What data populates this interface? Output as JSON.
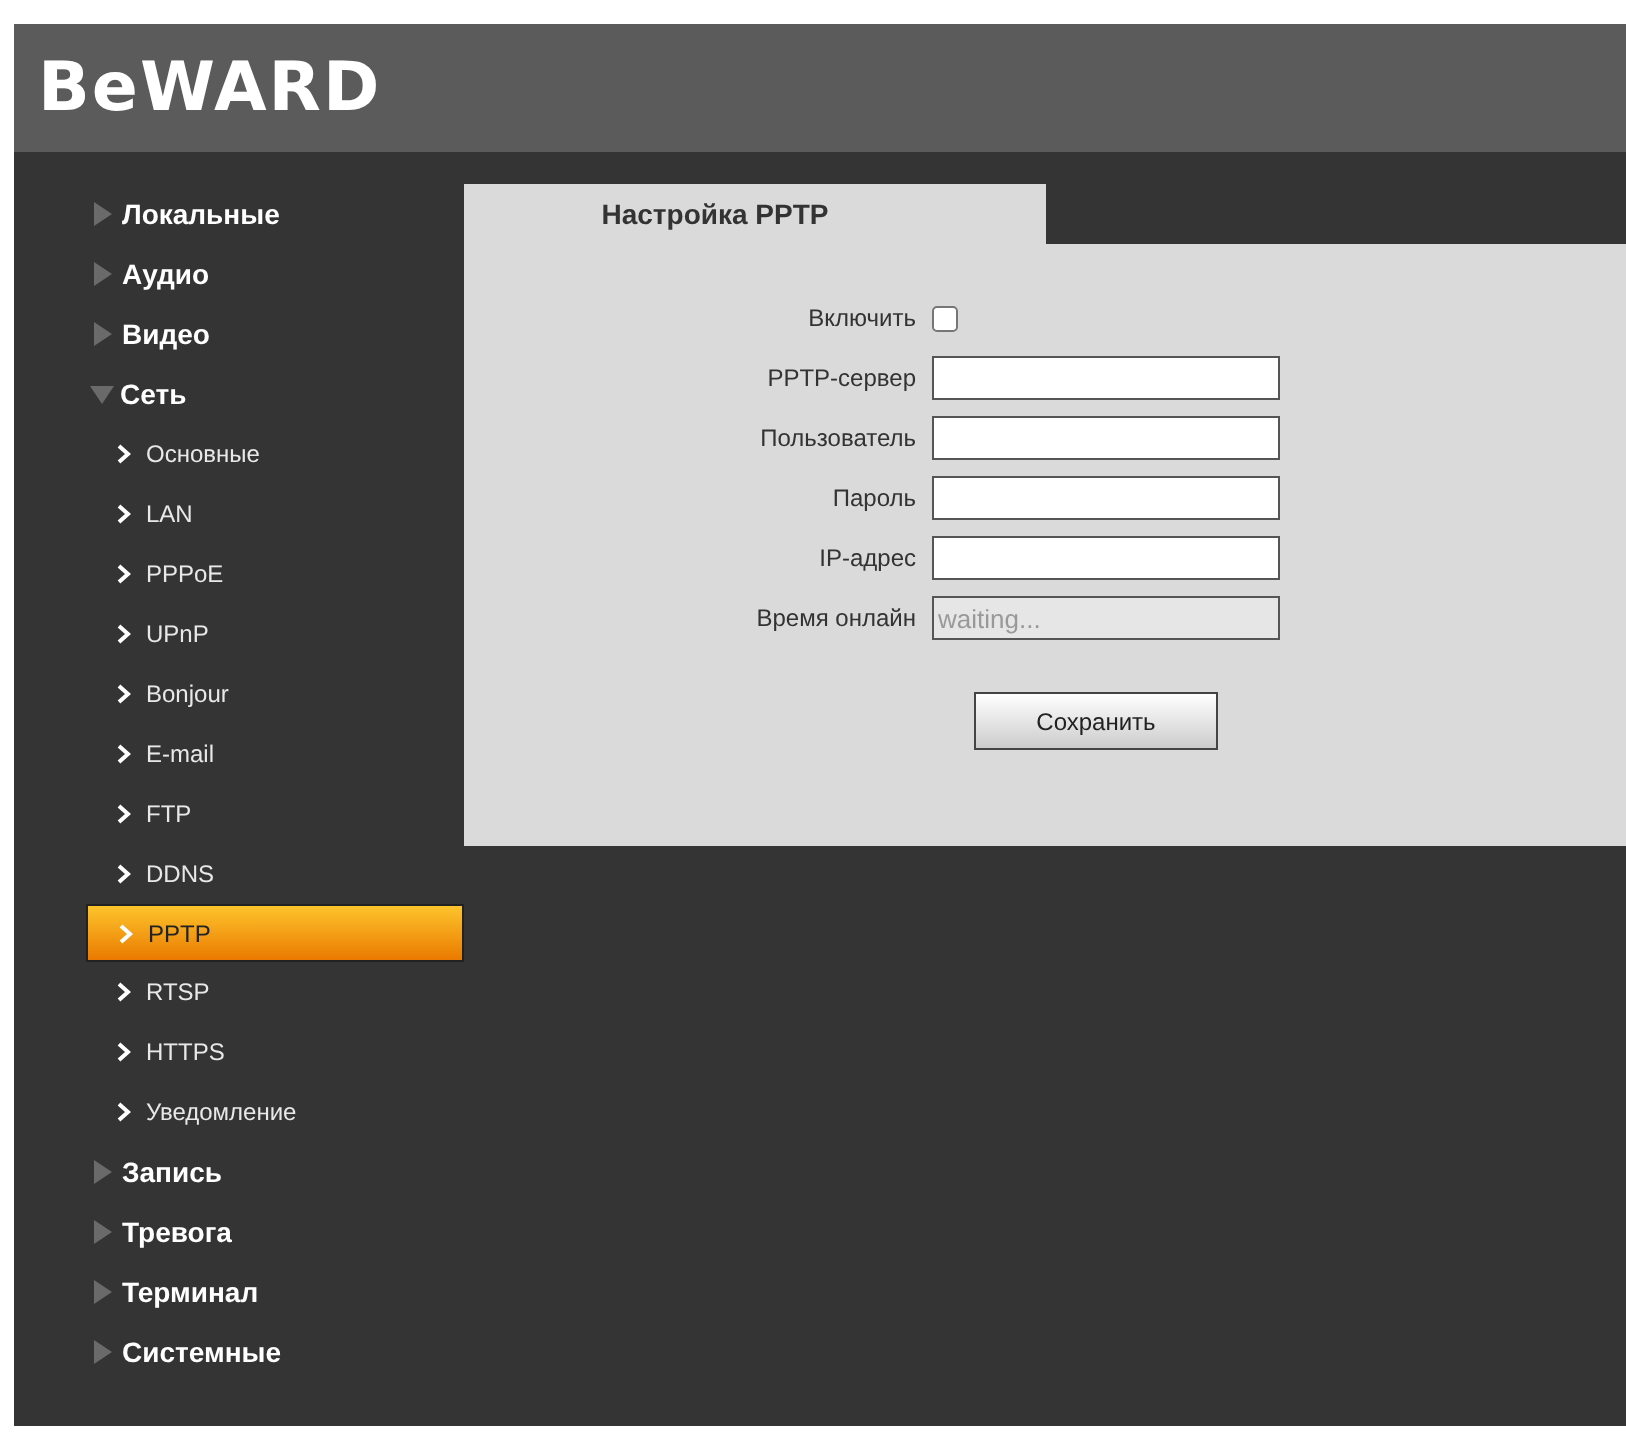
{
  "logo": {
    "text": "BeWARD"
  },
  "sidebar": {
    "items": [
      {
        "label": "Локальные",
        "expanded": false
      },
      {
        "label": "Аудио",
        "expanded": false
      },
      {
        "label": "Видео",
        "expanded": false
      },
      {
        "label": "Сеть",
        "expanded": true,
        "children": [
          {
            "label": "Основные",
            "selected": false
          },
          {
            "label": "LAN",
            "selected": false
          },
          {
            "label": "PPPoE",
            "selected": false
          },
          {
            "label": "UPnP",
            "selected": false
          },
          {
            "label": "Bonjour",
            "selected": false
          },
          {
            "label": "E-mail",
            "selected": false
          },
          {
            "label": "FTP",
            "selected": false
          },
          {
            "label": "DDNS",
            "selected": false
          },
          {
            "label": "PPTP",
            "selected": true
          },
          {
            "label": "RTSP",
            "selected": false
          },
          {
            "label": "HTTPS",
            "selected": false
          },
          {
            "label": "Уведомление",
            "selected": false
          }
        ]
      },
      {
        "label": "Запись",
        "expanded": false
      },
      {
        "label": "Тревога",
        "expanded": false
      },
      {
        "label": "Терминал",
        "expanded": false
      },
      {
        "label": "Системные",
        "expanded": false
      }
    ]
  },
  "panel": {
    "tab": {
      "label": "Настройка PPTP",
      "selected": true
    },
    "fields": [
      {
        "kind": "checkbox",
        "label": "Включить",
        "checked": false
      },
      {
        "kind": "text",
        "label": "PPTP-сервер",
        "disabled": false
      },
      {
        "kind": "text",
        "label": "Пользователь",
        "disabled": false
      },
      {
        "kind": "text",
        "label": "Пароль",
        "disabled": false
      },
      {
        "kind": "text",
        "label": "IP-адрес",
        "disabled": false
      },
      {
        "kind": "text",
        "label": "Время онлайн",
        "value": "waiting...",
        "disabled": true
      }
    ],
    "save_button": "Сохранить"
  }
}
